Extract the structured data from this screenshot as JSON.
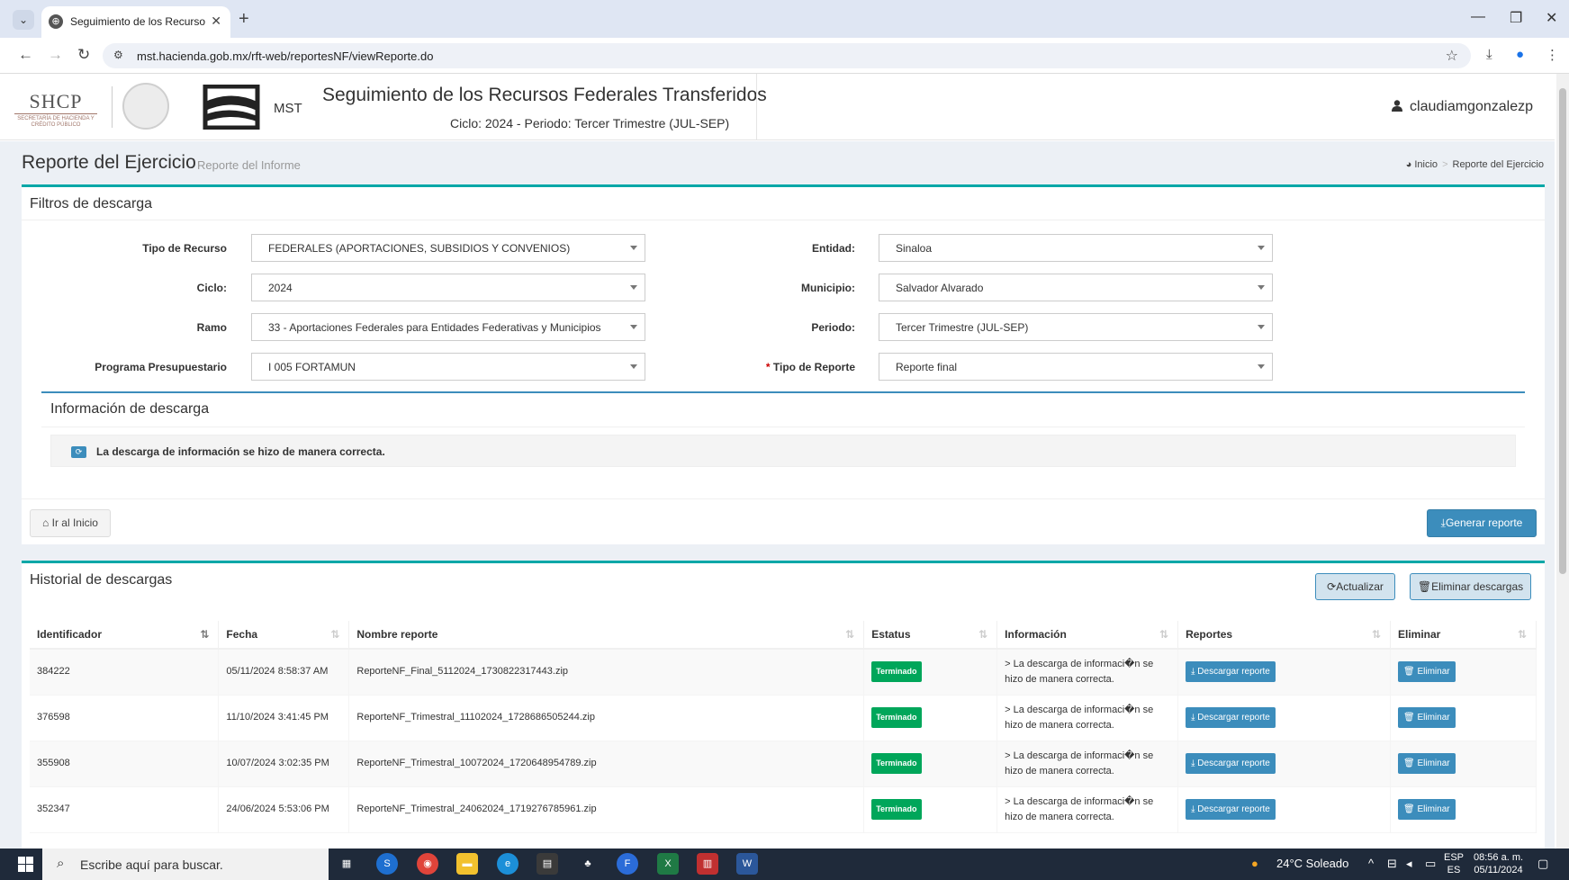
{
  "browser": {
    "tab_title": "Seguimiento de los Recursos F",
    "url": "mst.hacienda.gob.mx/rft-web/reportesNF/viewReporte.do"
  },
  "header": {
    "shcp": "SHCP",
    "shcp_sub": "SECRETARÍA DE HACIENDA Y CRÉDITO PÚBLICO",
    "mst": "MST",
    "title": "Seguimiento de los Recursos Federales Transferidos",
    "subtitle": "Ciclo: 2024 - Periodo: Tercer Trimestre (JUL-SEP)",
    "user": "claudiamgonzalezp"
  },
  "page": {
    "title": "Reporte del Ejercicio",
    "subtitle": "Reporte del Informe",
    "breadcrumb_home": "Inicio",
    "breadcrumb_current": "Reporte del Ejercicio"
  },
  "filters": {
    "title": "Filtros de descarga",
    "tipo_recurso_label": "Tipo de Recurso",
    "tipo_recurso": "FEDERALES (APORTACIONES, SUBSIDIOS Y CONVENIOS)",
    "ciclo_label": "Ciclo:",
    "ciclo": "2024",
    "ramo_label": "Ramo",
    "ramo": "33 - Aportaciones Federales para Entidades Federativas y Municipios",
    "programa_label": "Programa Presupuestario",
    "programa": "I 005 FORTAMUN",
    "entidad_label": "Entidad:",
    "entidad": "Sinaloa",
    "municipio_label": "Municipio:",
    "municipio": "Salvador Alvarado",
    "periodo_label": "Periodo:",
    "periodo": "Tercer Trimestre (JUL-SEP)",
    "tipo_reporte_label": "Tipo de Reporte",
    "tipo_reporte_req": "*",
    "tipo_reporte": "Reporte final"
  },
  "info": {
    "title": "Información de descarga",
    "message": "La descarga de información se hizo de manera correcta."
  },
  "actions": {
    "home": "Ir al Inicio",
    "generate": "Generar reporte"
  },
  "history": {
    "title": "Historial de descargas",
    "refresh": "Actualizar",
    "delete_all": "Eliminar descargas",
    "columns": [
      "Identificador",
      "Fecha",
      "Nombre reporte",
      "Estatus",
      "Información",
      "Reportes",
      "Eliminar"
    ],
    "status_label": "Terminado",
    "download_label": "Descargar reporte",
    "delete_label": "Eliminar",
    "rows": [
      {
        "id": "384222",
        "fecha": "05/11/2024 8:58:37 AM",
        "nombre": "ReporteNF_Final_5112024_1730822317443.zip",
        "info": "> La descarga de informaci�n se hizo de manera correcta."
      },
      {
        "id": "376598",
        "fecha": "11/10/2024 3:41:45 PM",
        "nombre": "ReporteNF_Trimestral_11102024_1728686505244.zip",
        "info": "> La descarga de informaci�n se hizo de manera correcta."
      },
      {
        "id": "355908",
        "fecha": "10/07/2024 3:02:35 PM",
        "nombre": "ReporteNF_Trimestral_10072024_1720648954789.zip",
        "info": "> La descarga de informaci�n se hizo de manera correcta."
      },
      {
        "id": "352347",
        "fecha": "24/06/2024 5:53:06 PM",
        "nombre": "ReporteNF_Trimestral_24062024_1719276785961.zip",
        "info": "> La descarga de informaci�n se hizo de manera correcta."
      }
    ]
  },
  "taskbar": {
    "search_placeholder": "Escribe aquí para buscar.",
    "weather": "24°C Soleado",
    "lang": "ESP",
    "lang2": "ES",
    "time": "08:56 a. m.",
    "date": "05/11/2024"
  }
}
